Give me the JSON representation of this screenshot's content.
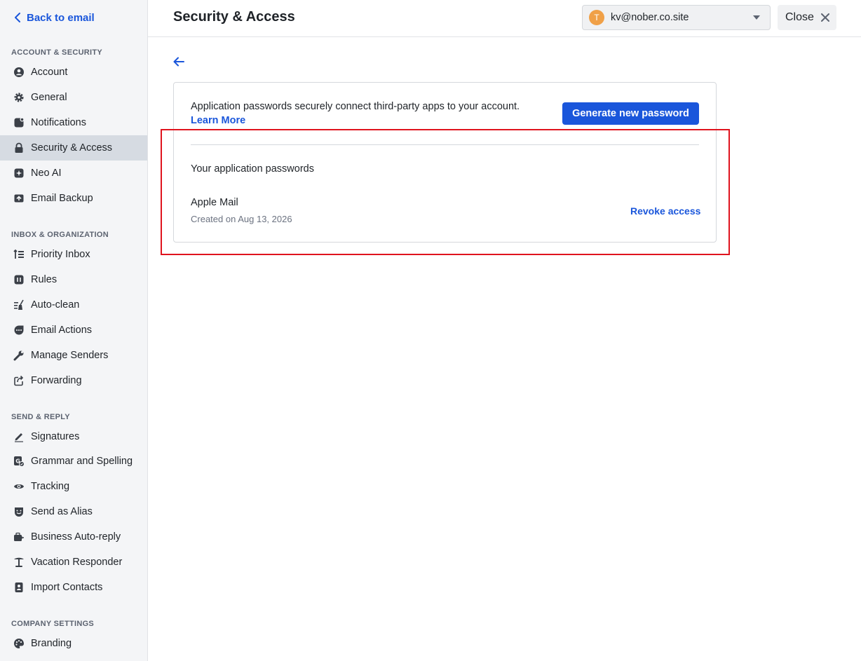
{
  "sidebar": {
    "back_label": "Back to email",
    "sections": {
      "account": "ACCOUNT & SECURITY",
      "inbox": "INBOX & ORGANIZATION",
      "send": "SEND & REPLY",
      "company": "COMPANY SETTINGS"
    },
    "items": [
      {
        "label": "Account",
        "icon": "account-icon"
      },
      {
        "label": "General",
        "icon": "gear-icon"
      },
      {
        "label": "Notifications",
        "icon": "notification-icon"
      },
      {
        "label": "Security & Access",
        "icon": "lock-icon",
        "active": true
      },
      {
        "label": "Neo AI",
        "icon": "sparkle-icon"
      },
      {
        "label": "Email Backup",
        "icon": "backup-icon"
      },
      {
        "label": "Priority Inbox",
        "icon": "priority-icon"
      },
      {
        "label": "Rules",
        "icon": "rules-icon"
      },
      {
        "label": "Auto-clean",
        "icon": "broom-icon"
      },
      {
        "label": "Email Actions",
        "icon": "actions-icon"
      },
      {
        "label": "Manage Senders",
        "icon": "wrench-icon"
      },
      {
        "label": "Forwarding",
        "icon": "forward-icon"
      },
      {
        "label": "Signatures",
        "icon": "pen-icon"
      },
      {
        "label": "Grammar and Spelling",
        "icon": "grammar-icon"
      },
      {
        "label": "Tracking",
        "icon": "eye-icon"
      },
      {
        "label": "Send as Alias",
        "icon": "alias-icon"
      },
      {
        "label": "Business Auto-reply",
        "icon": "briefcase-reply-icon"
      },
      {
        "label": "Vacation Responder",
        "icon": "palm-tree-icon"
      },
      {
        "label": "Import Contacts",
        "icon": "contacts-icon"
      },
      {
        "label": "Branding",
        "icon": "palette-icon"
      }
    ]
  },
  "header": {
    "title": "Security & Access",
    "account_initial": "T",
    "account_email": "kv@nober.co.site",
    "close_label": "Close"
  },
  "main": {
    "description": "Application passwords securely connect third-party apps to your account.",
    "learn_more": "Learn More",
    "generate_label": "Generate new password",
    "section_label": "Your application passwords",
    "passwords": [
      {
        "name": "Apple Mail",
        "created": "Created on Aug 13, 2026",
        "action": "Revoke access"
      }
    ]
  },
  "colors": {
    "accent": "#1a56db",
    "highlight": "#e0141e",
    "avatar": "#f0a047"
  }
}
